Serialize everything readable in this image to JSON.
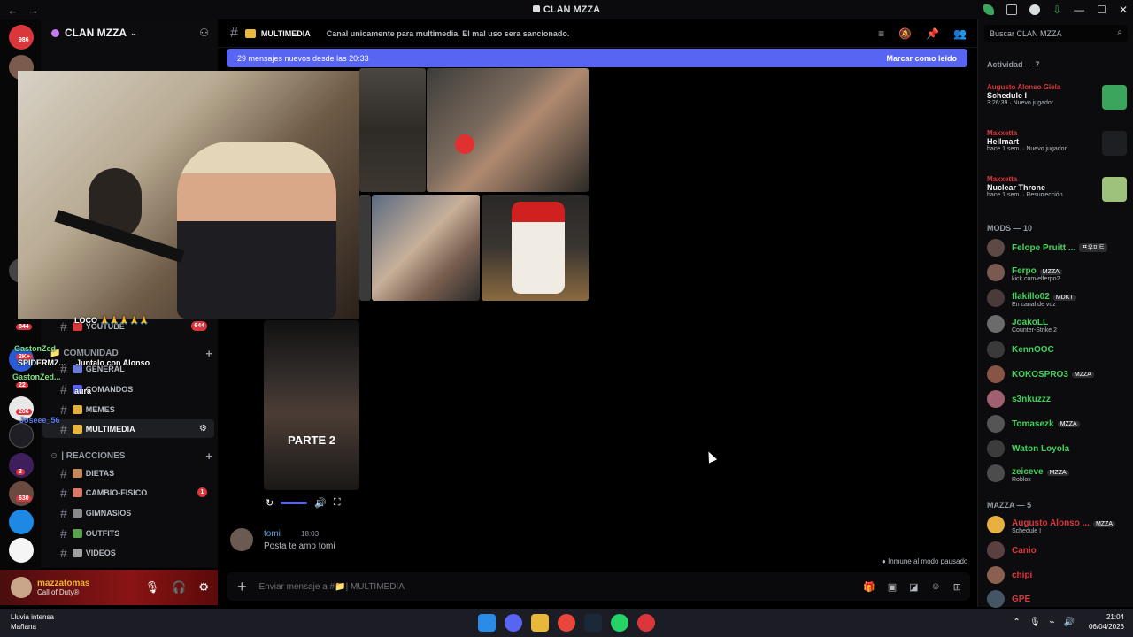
{
  "window": {
    "title": "CLAN MZZA"
  },
  "rail": {
    "badges": [
      "986",
      "844",
      "2K+",
      "22",
      "206",
      "3",
      "630"
    ]
  },
  "sidebar": {
    "guild_name": "CLAN MZZA",
    "categories": [
      {
        "label": "COMUNIDAD"
      },
      {
        "label": "| REACCIONES"
      }
    ],
    "channels": [
      {
        "label": "YOUTUBE",
        "badge": "644"
      },
      {
        "label": "GENERAL"
      },
      {
        "label": "COMANDOS"
      },
      {
        "label": "MEMES"
      },
      {
        "label": "MULTIMEDIA"
      },
      {
        "label": "DIETAS"
      },
      {
        "label": "CAMBIO-FISICO",
        "badge": "1"
      },
      {
        "label": "GIMNASIOS"
      },
      {
        "label": "OUTFITS"
      },
      {
        "label": "VIDEOS"
      }
    ]
  },
  "user": {
    "name": "mazzatomas",
    "status": "Call of Duty®"
  },
  "header": {
    "channel_name": "MULTIMEDIA",
    "topic": "Canal unicamente para multimedia. El mal uso sera sancionado."
  },
  "banner": {
    "text": "29 mensajes nuevos desde las 20:33",
    "action": "Marcar como leído"
  },
  "media": {
    "video_label": "PARTE 2"
  },
  "overlay_chat": [
    {
      "text": "LOCO 🙏🙏🙏🙏🙏",
      "color": "#ffffff"
    },
    {
      "text": "GastonZed",
      "color": "#7be37b"
    },
    {
      "text": "SPIDERMZ...",
      "color": "#ffffff"
    },
    {
      "text": "Juntalo con Alonso",
      "color": "#ffffff"
    },
    {
      "text": "GastonZed...",
      "color": "#7be37b"
    },
    {
      "text": "aura",
      "color": "#ffffff"
    },
    {
      "text": "Joseee_56",
      "color": "#5a7df2"
    }
  ],
  "message": {
    "author": "tomi",
    "time": "18:03",
    "body": "Posta te amo tomi"
  },
  "status_note": "Inmune al modo pausado",
  "composer": {
    "placeholder": "Enviar mensaje a #📁| MULTIMEDIA"
  },
  "right_panel": {
    "search_placeholder": "Buscar CLAN MZZA",
    "activity_header": "Actividad — 7",
    "activities": [
      {
        "user": "Augusto Alonso Glela",
        "game": "Schedule I",
        "meta": "3:26:39 · Nuevo jugador",
        "color": "#3ba55d"
      },
      {
        "user": "Maxxetta",
        "game": "Hellmart",
        "meta": "hace 1 sem. · Nuevo jugador",
        "color": "#1e1f22"
      },
      {
        "user": "Maxxetta",
        "game": "Nuclear Throne",
        "meta": "hace 1 sem. · Resurrección",
        "color": "#9ec27c"
      }
    ],
    "mods_header": "MODS — 10",
    "mods": [
      {
        "name": "Felope Pruitt ...",
        "tag": "프우미트",
        "sub": "",
        "color": "#43d15b",
        "avatar": "#5d4a44"
      },
      {
        "name": "Ferpo",
        "tag": "MZZA",
        "sub": "kick.com/elferpo2",
        "color": "#43d15b",
        "avatar": "#7a5a50"
      },
      {
        "name": "flakillo02",
        "tag": "MDKT",
        "sub": "En canal de voz",
        "color": "#43d15b",
        "avatar": "#4a3a3a"
      },
      {
        "name": "JoakoLL",
        "tag": "",
        "sub": "Counter-Strike 2",
        "color": "#43d15b",
        "avatar": "#6b6b6b"
      },
      {
        "name": "KennOOC",
        "tag": "",
        "sub": "",
        "color": "#43d15b",
        "avatar": "#3a3a3a"
      },
      {
        "name": "KOKOSPRO3",
        "tag": "MZZA",
        "sub": "",
        "color": "#43d15b",
        "avatar": "#885544"
      },
      {
        "name": "s3nkuzzz",
        "tag": "",
        "sub": "",
        "color": "#43d15b",
        "avatar": "#a06070"
      },
      {
        "name": "Tomasezk",
        "tag": "MZZA",
        "sub": "",
        "color": "#43d15b",
        "avatar": "#555555"
      },
      {
        "name": "Waton Loyola",
        "tag": "",
        "sub": "",
        "color": "#43d15b",
        "avatar": "#3c3c3c"
      },
      {
        "name": "zeiceve",
        "tag": "MZZA",
        "sub": "Roblox",
        "color": "#43d15b",
        "avatar": "#4c4c4c"
      }
    ],
    "mazza_header": "MAZZA — 5",
    "mazza": [
      {
        "name": "Augusto Alonso ...",
        "tag": "MZZA",
        "sub": "Schedule I",
        "color": "#da373c",
        "avatar": "#e8b040"
      },
      {
        "name": "Canio",
        "tag": "",
        "sub": "",
        "color": "#da373c",
        "avatar": "#5a4040"
      },
      {
        "name": "chipi",
        "tag": "",
        "sub": "",
        "color": "#da373c",
        "avatar": "#8a6050"
      },
      {
        "name": "GPE",
        "tag": "",
        "sub": "",
        "color": "#da373c",
        "avatar": "#445566"
      }
    ]
  },
  "taskbar": {
    "weather": "Lluvia intensa",
    "weather_sub": "Mañana",
    "time": "21:04",
    "date": "06/04/2026"
  }
}
